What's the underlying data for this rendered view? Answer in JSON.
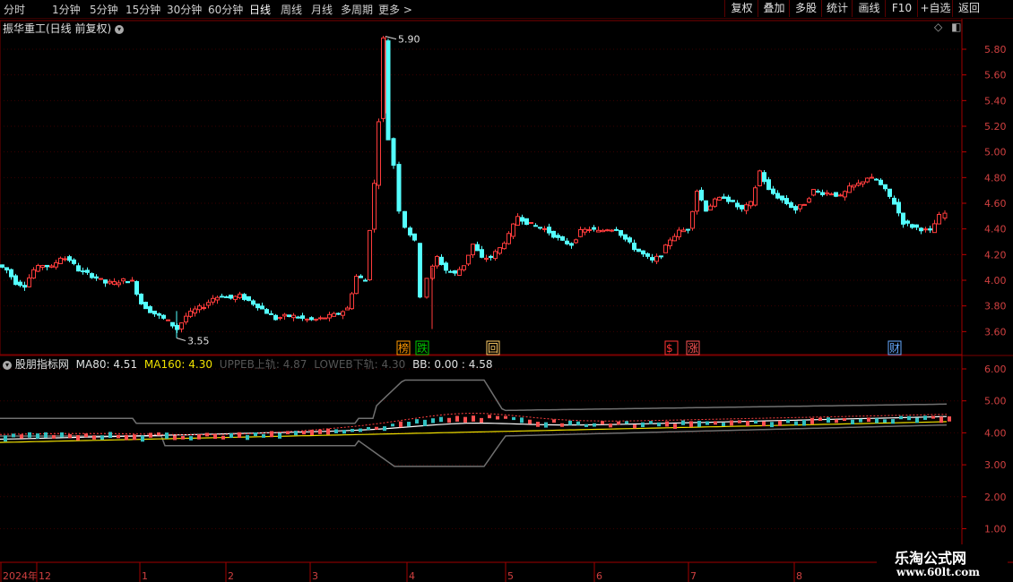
{
  "toolbar": {
    "periods": [
      "分时",
      "1分钟",
      "5分钟",
      "15分钟",
      "30分钟",
      "60分钟",
      "日线",
      "周线",
      "月线",
      "多周期",
      "更多 >"
    ],
    "active_period": "日线",
    "tools": [
      "复权",
      "叠加",
      "多股",
      "统计",
      "画线",
      "F10",
      "+自选",
      "返回"
    ]
  },
  "main_panel": {
    "title": "振华重工(日线 前复权)",
    "high_label": "5.90",
    "low_label": "3.55",
    "markers": [
      {
        "text": "榜",
        "color": "#ff9900"
      },
      {
        "text": "跌",
        "color": "#00cc00"
      },
      {
        "text": "回",
        "color": "#ffcc66"
      },
      {
        "text": "$",
        "color": "#ff3333"
      },
      {
        "text": "涨",
        "color": "#ff5555"
      },
      {
        "text": "财",
        "color": "#66aaff"
      }
    ],
    "yticks": [
      "5.80",
      "5.60",
      "5.40",
      "5.20",
      "5.00",
      "4.80",
      "4.60",
      "4.40",
      "4.20",
      "4.00",
      "3.80",
      "3.60"
    ]
  },
  "indicator_panel": {
    "name": "股朋指标网",
    "ma80_label": "MA80: 4.51",
    "ma160_label": "MA160: 4.30",
    "upper_label": "UPPEB上轨: 4.87",
    "lower_label": "LOWEB下轨: 4.30",
    "bb_label": "BB: 0.00 : 4.58",
    "yticks": [
      "6.00",
      "5.00",
      "4.00",
      "3.00",
      "2.00",
      "1.00"
    ]
  },
  "x_axis": {
    "labels": [
      "2024年",
      "12",
      "1",
      "2",
      "3",
      "4",
      "5",
      "6",
      "7",
      "8"
    ]
  },
  "watermark": {
    "line1": "乐淘公式网",
    "line2": "www.60lt.com"
  },
  "chart_data": {
    "type": "candlestick",
    "title": "振华重工(日线 前复权)",
    "close_path": [
      [
        0,
        4.12
      ],
      [
        10,
        4.08
      ],
      [
        20,
        3.98
      ],
      [
        30,
        3.96
      ],
      [
        40,
        4.08
      ],
      [
        50,
        4.12
      ],
      [
        60,
        4.1
      ],
      [
        70,
        4.18
      ],
      [
        80,
        4.16
      ],
      [
        90,
        4.08
      ],
      [
        100,
        4.05
      ],
      [
        110,
        4.02
      ],
      [
        120,
        3.98
      ],
      [
        130,
        3.98
      ],
      [
        140,
        4.0
      ],
      [
        150,
        3.99
      ],
      [
        160,
        3.82
      ],
      [
        170,
        3.76
      ],
      [
        180,
        3.72
      ],
      [
        190,
        3.68
      ],
      [
        200,
        3.62
      ],
      [
        210,
        3.72
      ],
      [
        220,
        3.77
      ],
      [
        230,
        3.8
      ],
      [
        240,
        3.86
      ],
      [
        250,
        3.88
      ],
      [
        260,
        3.86
      ],
      [
        270,
        3.88
      ],
      [
        280,
        3.84
      ],
      [
        290,
        3.8
      ],
      [
        300,
        3.75
      ],
      [
        310,
        3.7
      ],
      [
        320,
        3.72
      ],
      [
        330,
        3.72
      ],
      [
        340,
        3.7
      ],
      [
        350,
        3.69
      ],
      [
        360,
        3.7
      ],
      [
        370,
        3.72
      ],
      [
        380,
        3.74
      ],
      [
        390,
        3.78
      ],
      [
        400,
        4.03
      ],
      [
        410,
        4.0
      ],
      [
        415,
        4.4
      ],
      [
        420,
        4.75
      ],
      [
        425,
        5.25
      ],
      [
        430,
        5.88
      ],
      [
        436,
        5.1
      ],
      [
        442,
        4.9
      ],
      [
        448,
        4.55
      ],
      [
        455,
        4.42
      ],
      [
        465,
        4.3
      ],
      [
        472,
        3.88
      ],
      [
        480,
        4.02
      ],
      [
        490,
        4.18
      ],
      [
        500,
        4.08
      ],
      [
        510,
        4.05
      ],
      [
        520,
        4.12
      ],
      [
        530,
        4.28
      ],
      [
        540,
        4.17
      ],
      [
        550,
        4.18
      ],
      [
        560,
        4.25
      ],
      [
        570,
        4.35
      ],
      [
        580,
        4.5
      ],
      [
        590,
        4.45
      ],
      [
        600,
        4.42
      ],
      [
        610,
        4.4
      ],
      [
        620,
        4.35
      ],
      [
        630,
        4.3
      ],
      [
        640,
        4.28
      ],
      [
        650,
        4.38
      ],
      [
        660,
        4.4
      ],
      [
        670,
        4.38
      ],
      [
        680,
        4.4
      ],
      [
        690,
        4.4
      ],
      [
        700,
        4.32
      ],
      [
        710,
        4.25
      ],
      [
        720,
        4.2
      ],
      [
        730,
        4.15
      ],
      [
        740,
        4.2
      ],
      [
        750,
        4.32
      ],
      [
        760,
        4.38
      ],
      [
        770,
        4.4
      ],
      [
        780,
        4.7
      ],
      [
        790,
        4.55
      ],
      [
        800,
        4.62
      ],
      [
        810,
        4.65
      ],
      [
        820,
        4.6
      ],
      [
        830,
        4.55
      ],
      [
        840,
        4.6
      ],
      [
        850,
        4.85
      ],
      [
        860,
        4.7
      ],
      [
        870,
        4.65
      ],
      [
        880,
        4.6
      ],
      [
        890,
        4.55
      ],
      [
        900,
        4.6
      ],
      [
        910,
        4.7
      ],
      [
        920,
        4.68
      ],
      [
        930,
        4.68
      ],
      [
        940,
        4.65
      ],
      [
        950,
        4.72
      ],
      [
        960,
        4.75
      ],
      [
        970,
        4.8
      ],
      [
        980,
        4.78
      ],
      [
        990,
        4.7
      ],
      [
        1000,
        4.6
      ],
      [
        1010,
        4.45
      ],
      [
        1020,
        4.42
      ],
      [
        1030,
        4.4
      ],
      [
        1040,
        4.38
      ],
      [
        1050,
        4.5
      ],
      [
        1058,
        4.52
      ]
    ],
    "high": 5.9,
    "low": 3.55,
    "ylim": [
      3.55,
      5.9
    ],
    "indicator": {
      "ma80": 4.51,
      "ma160": 4.3,
      "upper": 4.87,
      "lower": 4.3,
      "bb": [
        0.0,
        4.58
      ],
      "ylim": [
        1.0,
        6.0
      ]
    }
  }
}
